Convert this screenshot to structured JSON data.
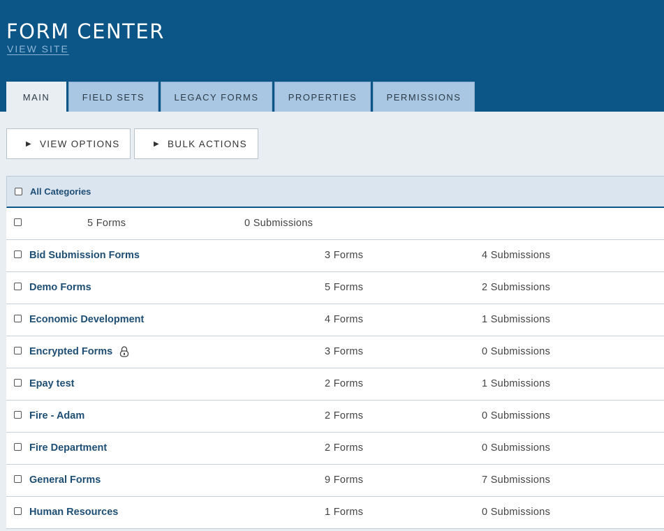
{
  "header": {
    "title": "FORM CENTER",
    "view_site": "VIEW SITE"
  },
  "tabs": [
    {
      "label": "MAIN",
      "active": true
    },
    {
      "label": "FIELD SETS"
    },
    {
      "label": "LEGACY FORMS"
    },
    {
      "label": "PROPERTIES"
    },
    {
      "label": "PERMISSIONS"
    }
  ],
  "toolbar": {
    "view_options": "VIEW OPTIONS",
    "bulk_actions": "BULK ACTIONS",
    "arrow": "▶"
  },
  "grid": {
    "header_label": "All Categories",
    "summary": {
      "forms": "5  Forms",
      "submissions": "0  Submissions"
    },
    "rows": [
      {
        "name": "Bid Submission Forms",
        "forms": "3  Forms",
        "submissions": "4  Submissions"
      },
      {
        "name": "Demo Forms",
        "forms": "5  Forms",
        "submissions": "2  Submissions"
      },
      {
        "name": "Economic Development",
        "forms": "4  Forms",
        "submissions": "1  Submissions"
      },
      {
        "name": "Encrypted Forms",
        "forms": "3  Forms",
        "submissions": "0  Submissions",
        "locked": true
      },
      {
        "name": "Epay test",
        "forms": "2  Forms",
        "submissions": "1  Submissions"
      },
      {
        "name": "Fire - Adam",
        "forms": "2  Forms",
        "submissions": "0  Submissions"
      },
      {
        "name": "Fire Department",
        "forms": "2  Forms",
        "submissions": "0  Submissions"
      },
      {
        "name": "General Forms",
        "forms": "9  Forms",
        "submissions": "7  Submissions"
      },
      {
        "name": "Human Resources",
        "forms": "1  Forms",
        "submissions": "0  Submissions"
      }
    ]
  },
  "icons": {
    "lock": "lock-icon"
  },
  "colors": {
    "header_bg": "#0b5587",
    "tab_bg": "#a9c7e3",
    "link": "#1f4e75"
  }
}
